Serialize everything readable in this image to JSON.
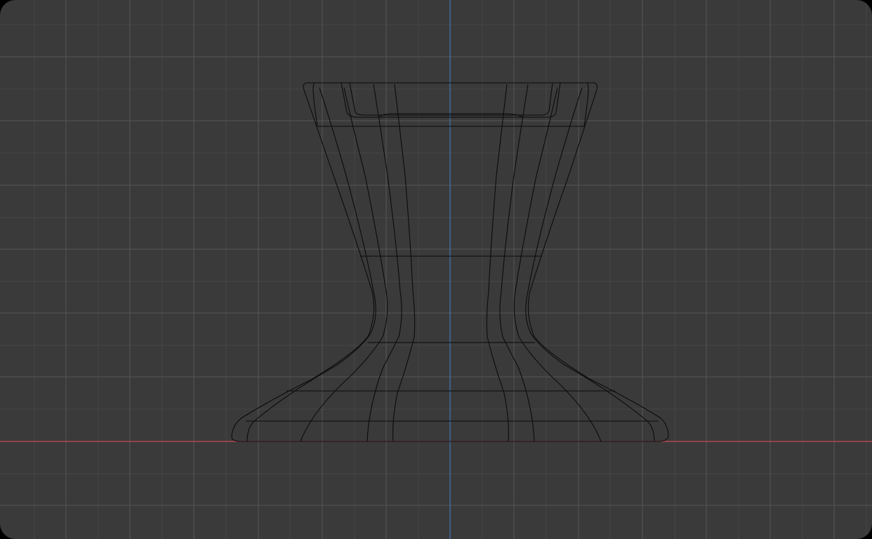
{
  "viewport": {
    "view": "front-orthographic",
    "background_color": "#3a3a3a",
    "grid_minor_color": "#454545",
    "grid_major_color": "#555555",
    "x_axis_color": "#c24a4f",
    "z_axis_color": "#3f78b5",
    "wire_color": "#0b0b0b",
    "grid_visible": true
  },
  "mesh": {
    "name_icon": "mesh-object-icon",
    "display": "wireframe"
  }
}
